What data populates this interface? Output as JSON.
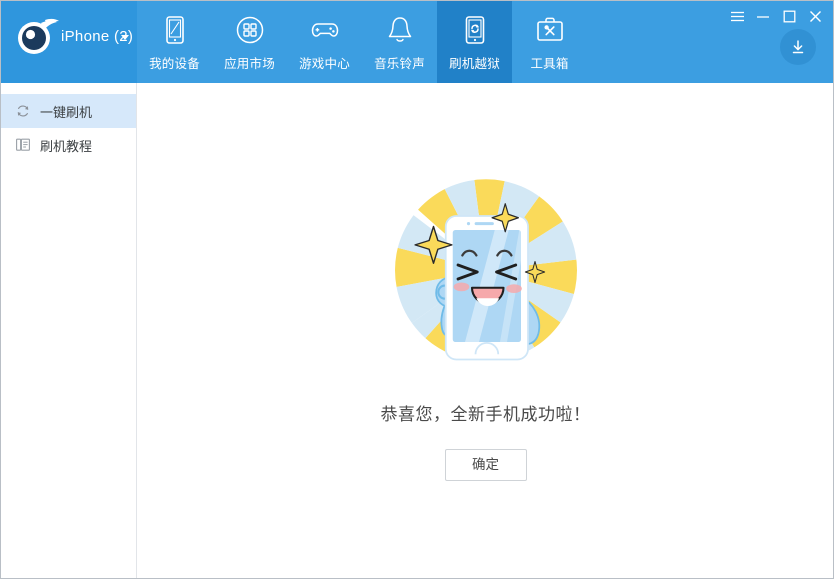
{
  "window": {
    "controls": [
      {
        "name": "menu",
        "label": "☰",
        "icon": "hamburger-menu-icon"
      },
      {
        "name": "minimize",
        "label": "─",
        "icon": "minimize-icon"
      },
      {
        "name": "maximize",
        "label": "□",
        "icon": "maximize-icon"
      },
      {
        "name": "close",
        "label": "✕",
        "icon": "close-icon"
      }
    ]
  },
  "header": {
    "brand": {
      "logo_icon": "pp-comet-eye-logo",
      "device_label": "iPhone (2)",
      "caret_icon": "chevron-down-icon"
    },
    "download_icon": "download-icon",
    "tabs": [
      {
        "label": "我的设备",
        "icon": "device-tablet-icon",
        "active": false
      },
      {
        "label": "应用市场",
        "icon": "app-grid-circle-icon",
        "active": false
      },
      {
        "label": "游戏中心",
        "icon": "gamepad-icon",
        "active": false
      },
      {
        "label": "音乐铃声",
        "icon": "bell-icon",
        "active": false
      },
      {
        "label": "刷机越狱",
        "icon": "flash-device-icon",
        "active": true
      },
      {
        "label": "工具箱",
        "icon": "toolbox-icon",
        "active": false
      }
    ]
  },
  "sidebar": {
    "items": [
      {
        "label": "一键刷机",
        "icon": "refresh-circle-icon",
        "selected": true
      },
      {
        "label": "刷机教程",
        "icon": "document-pages-icon",
        "selected": false
      }
    ]
  },
  "main": {
    "illustration": "happy-phone-mascot-sunburst",
    "message": "恭喜您，全新手机成功啦！",
    "confirm_label": "确定"
  },
  "colors": {
    "header_blue": "#3c9ee1",
    "brand_blue": "#2f96dd",
    "active_tab_blue": "#2181c8",
    "sidebar_selected": "#d6e8fa",
    "ray_yellow": "#fada5a",
    "ray_lightblue": "#d3e8f5",
    "phone_screen": "#aed7f4",
    "mouth_pink": "#f6a9ab"
  }
}
